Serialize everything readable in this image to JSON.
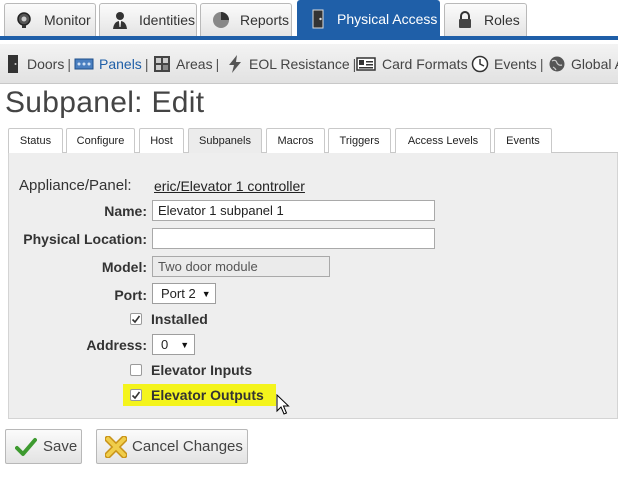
{
  "topnav": {
    "tabs": [
      {
        "label": "Monitor",
        "icon": "monitor-icon"
      },
      {
        "label": "Identities",
        "icon": "identities-icon"
      },
      {
        "label": "Reports",
        "icon": "reports-icon"
      },
      {
        "label": "Physical Access",
        "icon": "physical-access-icon",
        "active": true
      },
      {
        "label": "Roles",
        "icon": "roles-icon"
      }
    ]
  },
  "subnav": {
    "items": [
      {
        "label": "Doors",
        "icon": "door-icon"
      },
      {
        "label": "Panels",
        "icon": "panel-icon",
        "active": true
      },
      {
        "label": "Areas",
        "icon": "areas-icon"
      },
      {
        "label": "EOL Resistance",
        "icon": "lightning-icon"
      },
      {
        "label": "Card Formats",
        "icon": "card-icon"
      },
      {
        "label": "Events",
        "icon": "clock-icon"
      },
      {
        "label": "Global A",
        "icon": "globe-icon"
      }
    ],
    "separator": "|"
  },
  "page": {
    "title": "Subpanel: Edit"
  },
  "content_tabs": [
    "Status",
    "Configure",
    "Host",
    "Subpanels",
    "Macros",
    "Triggers",
    "Access Levels",
    "Events"
  ],
  "active_content_tab": "Subpanels",
  "form": {
    "appliance_label": "Appliance/Panel:",
    "appliance_value": "eric/Elevator 1 controller",
    "name_label": "Name:",
    "name_value": "Elevator 1 subpanel 1",
    "location_label": "Physical Location:",
    "location_value": "",
    "model_label": "Model:",
    "model_value": "Two door module",
    "port_label": "Port:",
    "port_value": "Port 2",
    "installed_label": "Installed",
    "installed_checked": true,
    "address_label": "Address:",
    "address_value": "0",
    "elevator_inputs_label": "Elevator Inputs",
    "elevator_inputs_checked": false,
    "elevator_outputs_label": "Elevator Outputs",
    "elevator_outputs_checked": true
  },
  "actions": {
    "save_label": "Save",
    "cancel_label": "Cancel Changes"
  },
  "colors": {
    "accent": "#1f5fa8",
    "highlight": "#f4f41c",
    "save_check": "#3d9a2f",
    "cancel_x": "#e5b92c"
  }
}
